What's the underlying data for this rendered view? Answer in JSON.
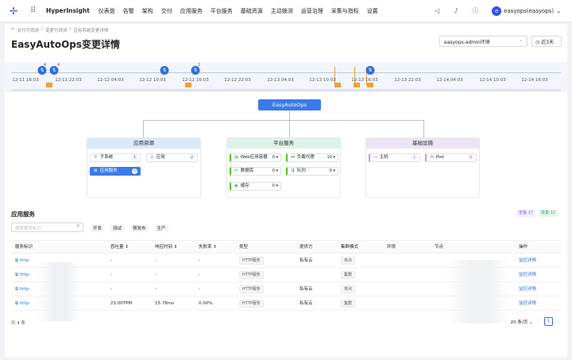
{
  "topbar": {
    "brand": "HyperInsight",
    "nav": [
      "仪表盘",
      "告警",
      "架构",
      "交付",
      "应用服务",
      "平台服务",
      "基础资源",
      "主动拨测",
      "运营治理",
      "采集与指标",
      "设置"
    ],
    "user": "easyops(easyops)"
  },
  "breadcrumb": [
    "交付可观测",
    "变更可观测",
    "应用系统变更详情"
  ],
  "page": {
    "title": "EasyAutoOps变更详情",
    "env_select": "easyops-admin环境",
    "range_button": "近3天"
  },
  "timeline": {
    "ticks": [
      "12-11 16:03",
      "12-11 22:03",
      "12-12 04:03",
      "12-12 10:03",
      "12-12 16:03",
      "12-12 22:03",
      "12-13 04:03",
      "12-13 10:03",
      "12-13 16:03",
      "12-13 22:03",
      "12-14 04:03",
      "12-14 10:03",
      "12-14 16:03"
    ],
    "counts": [
      "4",
      "4",
      "2"
    ]
  },
  "topology": {
    "center": "EasyAutoOps",
    "groups": [
      {
        "title": "应用资源",
        "items": [
          {
            "label": "子系统",
            "count": "1"
          },
          {
            "label": "应用",
            "count": "2"
          },
          {
            "label": "应用服务",
            "count": "4"
          }
        ]
      },
      {
        "title": "平台服务",
        "items": [
          {
            "label": "Web应用容器",
            "count": "0"
          },
          {
            "label": "负载代理",
            "count": "10"
          },
          {
            "label": "数据库",
            "count": "0"
          },
          {
            "label": "队列",
            "count": "0"
          },
          {
            "label": "缓存",
            "count": "0"
          }
        ]
      },
      {
        "title": "基础设施",
        "items": [
          {
            "label": "主机",
            "count": "1"
          },
          {
            "label": "Pod",
            "count": "0"
          }
        ]
      }
    ]
  },
  "section": {
    "title": "应用服务",
    "badge_alert": "告警",
    "badge_alert_count": "17",
    "badge_change": "变更",
    "badge_change_count": "12",
    "search_placeholder": "搜索服务标识",
    "filters": [
      "开发",
      "测试",
      "预发布",
      "生产"
    ]
  },
  "table": {
    "headers": [
      "服务标识",
      "吞吐量",
      "响应时间",
      "失败率",
      "类型",
      "提供方",
      "集群模式",
      "环境",
      "节点",
      "操作"
    ],
    "rows": [
      {
        "id": "http-",
        "throughput": "-",
        "latency": "-",
        "failure": "-",
        "type": "HTTP服务",
        "provider": "私有云",
        "mode": "单点",
        "action": "监控详情"
      },
      {
        "id": "http-",
        "throughput": "-",
        "latency": "-",
        "failure": "-",
        "type": "HTTP服务",
        "provider": "",
        "mode": "集群",
        "action": "监控详情"
      },
      {
        "id": "http-",
        "throughput": "-",
        "latency": "-",
        "failure": "-",
        "type": "HTTP服务",
        "provider": "私有云",
        "mode": "单点",
        "action": "监控详情"
      },
      {
        "id": "http-",
        "throughput": "23.00TPM",
        "latency": "15.78ms",
        "failure": "0.00%",
        "type": "HTTP服务",
        "provider": "私有云",
        "mode": "集群",
        "action": "监控详情"
      }
    ]
  },
  "footer": {
    "total": "共 4 条",
    "page_size": "20 条/页",
    "page": "1"
  },
  "colors": {
    "accent": "#2f6fe0",
    "warning": "#f0a030"
  }
}
